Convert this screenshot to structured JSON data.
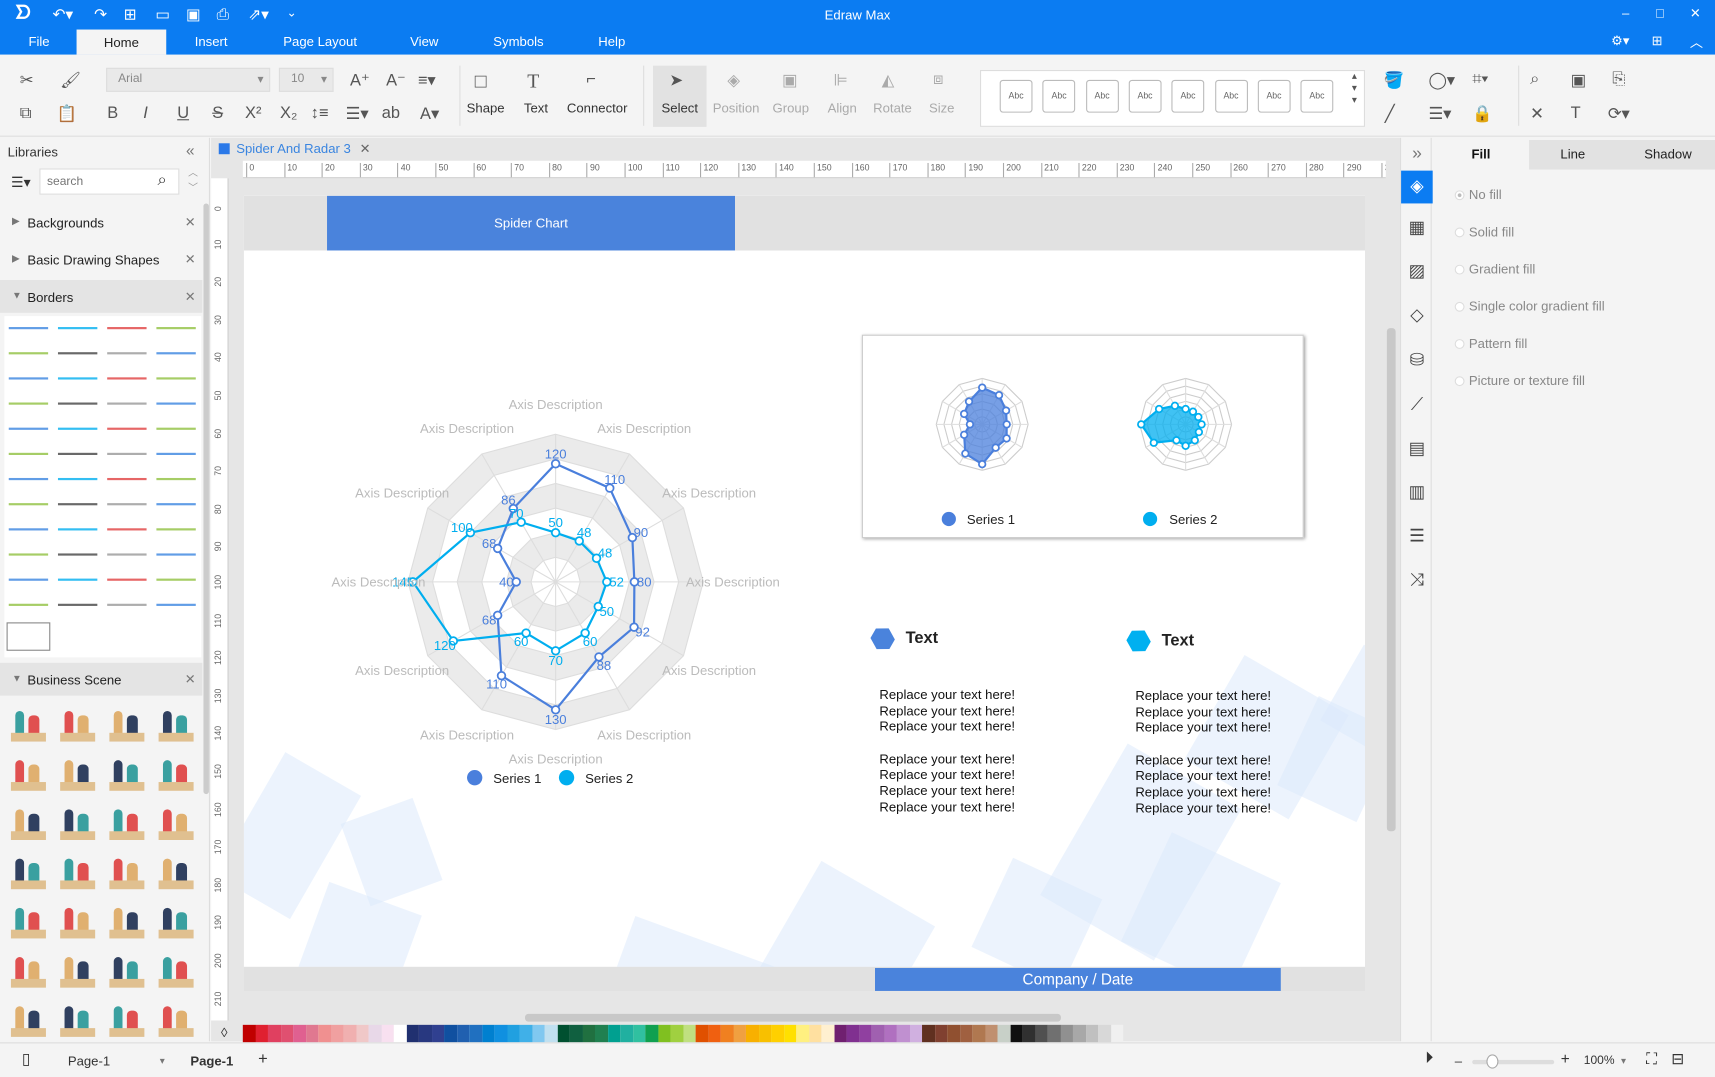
{
  "app": {
    "title": "Edraw Max"
  },
  "menu": [
    "File",
    "Home",
    "Insert",
    "Page Layout",
    "View",
    "Symbols",
    "Help"
  ],
  "ribbon": {
    "font": "Arial",
    "font_size": "10",
    "tools": [
      "Shape",
      "Text",
      "Connector",
      "Select",
      "Position",
      "Group",
      "Align",
      "Rotate",
      "Size"
    ],
    "style_label": "Abc"
  },
  "libraries": {
    "title": "Libraries",
    "search_placeholder": "search",
    "sections": [
      "Backgrounds",
      "Basic Drawing Shapes",
      "Borders",
      "Business Scene"
    ]
  },
  "document": {
    "tab": "Spider And Radar 3"
  },
  "rulers": {
    "h": [
      "0",
      "10",
      "20",
      "30",
      "40",
      "50",
      "60",
      "70",
      "80",
      "90",
      "100",
      "110",
      "120",
      "130",
      "140",
      "150",
      "160",
      "170",
      "180",
      "190",
      "200",
      "210",
      "220",
      "230",
      "240",
      "250",
      "260",
      "270",
      "280",
      "290",
      "30"
    ],
    "v": [
      "0",
      "10",
      "20",
      "30",
      "40",
      "50",
      "60",
      "70",
      "80",
      "90",
      "100",
      "110",
      "120",
      "130",
      "140",
      "150",
      "160",
      "170",
      "180",
      "190",
      "200",
      "210"
    ]
  },
  "page": {
    "header": "Spider Chart",
    "footer": "Company / Date",
    "text_blocks": [
      {
        "title": "Text",
        "color": "#4a83dc",
        "lines": [
          "Replace your text here!",
          "Replace your text here!",
          "Replace your text here!",
          "",
          "Replace your text here!",
          "Replace your text here!",
          "Replace your text here!",
          "Replace your text here!"
        ]
      },
      {
        "title": "Text",
        "color": "#00b0f0",
        "lines": [
          "Replace your text here!",
          "Replace your text here!",
          "Replace your text here!",
          "",
          "Replace your text here!",
          "Replace your text here!",
          "Replace your text here!",
          "Replace your text here!"
        ]
      }
    ]
  },
  "chart_data": {
    "type": "radar",
    "axes": [
      "Axis Description",
      "Axis Description",
      "Axis Description",
      "Axis Description",
      "Axis Description",
      "Axis Description",
      "Axis Description",
      "Axis Description",
      "Axis Description",
      "Axis Description",
      "Axis Description",
      "Axis Description"
    ],
    "rmax": 150,
    "series": [
      {
        "name": "Series 1",
        "color": "#4a7fdc",
        "values": [
          120,
          110,
          90,
          80,
          92,
          88,
          130,
          110,
          68,
          40,
          68,
          86
        ]
      },
      {
        "name": "Series 2",
        "color": "#00aeef",
        "values": [
          50,
          48,
          48,
          52,
          50,
          60,
          70,
          60,
          120,
          145,
          100,
          70
        ]
      }
    ],
    "legend": "bottom"
  },
  "properties": {
    "tabs": [
      "Fill",
      "Line",
      "Shadow"
    ],
    "options": [
      "No fill",
      "Solid fill",
      "Gradient fill",
      "Single color gradient fill",
      "Pattern fill",
      "Picture or texture fill"
    ],
    "selected": "No fill"
  },
  "palette": [
    "#c00000",
    "#e02030",
    "#e04060",
    "#e05070",
    "#e06090",
    "#e07890",
    "#f09090",
    "#f0a0a0",
    "#f0b0b0",
    "#f0c8c8",
    "#e8d8e8",
    "#f8e0f0",
    "#ffffff",
    "#203070",
    "#283880",
    "#304090",
    "#1050a0",
    "#2060b0",
    "#2070c0",
    "#0080d0",
    "#1090e0",
    "#20a0e0",
    "#40b0e8",
    "#80c8f0",
    "#c0e0f0",
    "#005030",
    "#106040",
    "#207040",
    "#208050",
    "#00a090",
    "#20b0a0",
    "#30c0a0",
    "#10a050",
    "#80c020",
    "#a0d040",
    "#c0e080",
    "#e05000",
    "#f06010",
    "#f08020",
    "#f0a040",
    "#f8b000",
    "#f8c000",
    "#ffd000",
    "#ffe000",
    "#fff080",
    "#ffe0a0",
    "#fff0d0",
    "#702070",
    "#803090",
    "#9040a0",
    "#a060b0",
    "#b070c0",
    "#c090d0",
    "#d0b0e0",
    "#603020",
    "#804030",
    "#905030",
    "#a06040",
    "#b07850",
    "#c09070",
    "#c8d0c8",
    "#101010",
    "#303030",
    "#505050",
    "#707070",
    "#909090",
    "#a8a8a8",
    "#c0c0c0",
    "#d8d8d8",
    "#f0f0f0"
  ],
  "status": {
    "page_select": "Page-1",
    "page_tab": "Page-1",
    "add": "+",
    "zoom": "100%"
  }
}
